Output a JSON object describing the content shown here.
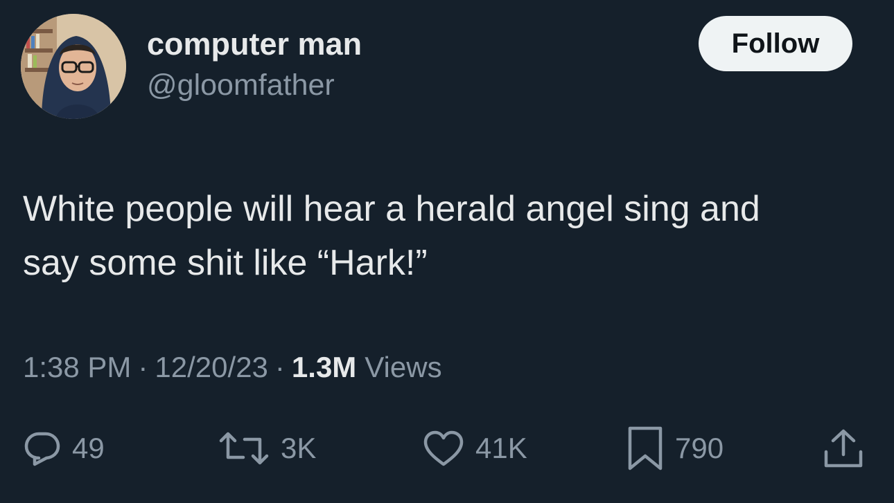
{
  "author": {
    "display_name": "computer man",
    "handle": "@gloomfather",
    "avatar_icon": "user-avatar"
  },
  "follow_button": {
    "label": "Follow"
  },
  "tweet": {
    "text_line1": "White people will hear a herald angel sing and",
    "text_line2": "say some shit like “Hark!”"
  },
  "meta": {
    "time": "1:38 PM",
    "separator": "·",
    "date": "12/20/23",
    "views_count": "1.3M",
    "views_label": "Views"
  },
  "actions": {
    "reply": {
      "icon": "reply-icon",
      "count": "49"
    },
    "retweet": {
      "icon": "retweet-icon",
      "count": "3K"
    },
    "like": {
      "icon": "heart-icon",
      "count": "41K"
    },
    "bookmark": {
      "icon": "bookmark-icon",
      "count": "790"
    },
    "share": {
      "icon": "share-icon"
    }
  },
  "colors": {
    "background": "#15202b",
    "primary_text": "#e7e9ea",
    "secondary_text": "#8b98a5",
    "follow_button_bg": "#eff3f4",
    "follow_button_text": "#0f1419"
  }
}
